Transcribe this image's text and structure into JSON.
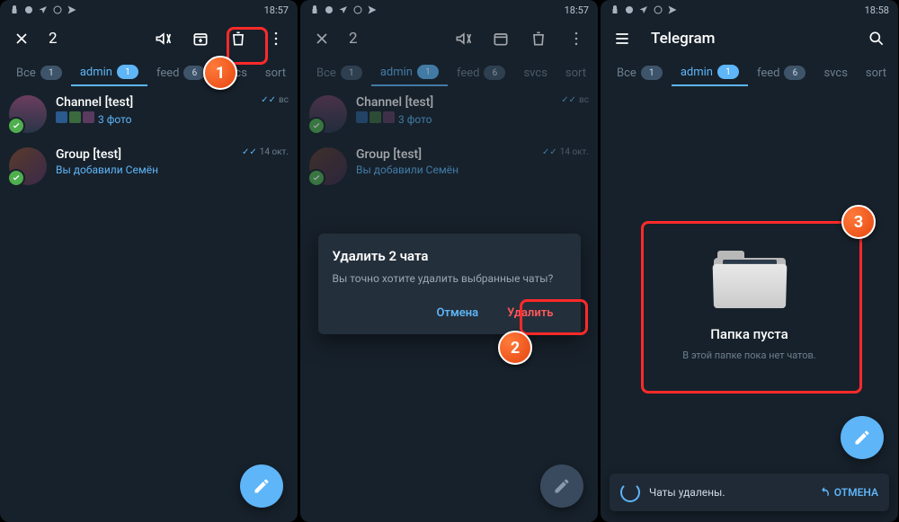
{
  "statusbar": {
    "time1": "18:57",
    "time2": "18:57",
    "time3": "18:58"
  },
  "selection": {
    "count": "2"
  },
  "app": {
    "title": "Telegram"
  },
  "tabs": [
    {
      "label": "Все",
      "count": "1"
    },
    {
      "label": "admin",
      "count": "1"
    },
    {
      "label": "feed",
      "count": "6"
    },
    {
      "label": "svcs",
      "count": ""
    },
    {
      "label": "sort",
      "count": ""
    }
  ],
  "chats": [
    {
      "title": "Channel [test]",
      "sub_prefix": "",
      "sub": "3 фото",
      "date": "вс",
      "has_thumbs": true
    },
    {
      "title": "Group [test]",
      "sub_prefix": "",
      "sub": "Вы добавили Семён",
      "date": "14 окт."
    }
  ],
  "dialog": {
    "title": "Удалить 2 чата",
    "text": "Вы точно хотите удалить выбранные чаты?",
    "cancel": "Отмена",
    "confirm": "Удалить"
  },
  "empty": {
    "title": "Папка пуста",
    "sub": "В этой папке пока нет чатов."
  },
  "snackbar": {
    "text": "Чаты удалены.",
    "action": "ОТМЕНА"
  },
  "steps": {
    "s1": "1",
    "s2": "2",
    "s3": "3"
  }
}
